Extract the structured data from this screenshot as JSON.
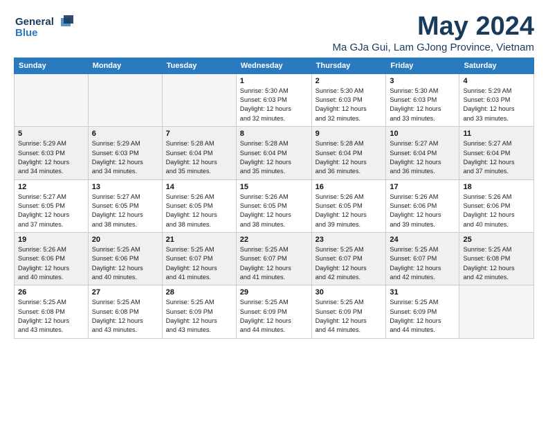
{
  "logo": {
    "line1": "General",
    "line2": "Blue"
  },
  "title": "May 2024",
  "location": "Ma GJa Gui, Lam GJong Province, Vietnam",
  "headers": [
    "Sunday",
    "Monday",
    "Tuesday",
    "Wednesday",
    "Thursday",
    "Friday",
    "Saturday"
  ],
  "weeks": [
    [
      {
        "day": "",
        "info": ""
      },
      {
        "day": "",
        "info": ""
      },
      {
        "day": "",
        "info": ""
      },
      {
        "day": "1",
        "info": "Sunrise: 5:30 AM\nSunset: 6:03 PM\nDaylight: 12 hours\nand 32 minutes."
      },
      {
        "day": "2",
        "info": "Sunrise: 5:30 AM\nSunset: 6:03 PM\nDaylight: 12 hours\nand 32 minutes."
      },
      {
        "day": "3",
        "info": "Sunrise: 5:30 AM\nSunset: 6:03 PM\nDaylight: 12 hours\nand 33 minutes."
      },
      {
        "day": "4",
        "info": "Sunrise: 5:29 AM\nSunset: 6:03 PM\nDaylight: 12 hours\nand 33 minutes."
      }
    ],
    [
      {
        "day": "5",
        "info": "Sunrise: 5:29 AM\nSunset: 6:03 PM\nDaylight: 12 hours\nand 34 minutes."
      },
      {
        "day": "6",
        "info": "Sunrise: 5:29 AM\nSunset: 6:03 PM\nDaylight: 12 hours\nand 34 minutes."
      },
      {
        "day": "7",
        "info": "Sunrise: 5:28 AM\nSunset: 6:04 PM\nDaylight: 12 hours\nand 35 minutes."
      },
      {
        "day": "8",
        "info": "Sunrise: 5:28 AM\nSunset: 6:04 PM\nDaylight: 12 hours\nand 35 minutes."
      },
      {
        "day": "9",
        "info": "Sunrise: 5:28 AM\nSunset: 6:04 PM\nDaylight: 12 hours\nand 36 minutes."
      },
      {
        "day": "10",
        "info": "Sunrise: 5:27 AM\nSunset: 6:04 PM\nDaylight: 12 hours\nand 36 minutes."
      },
      {
        "day": "11",
        "info": "Sunrise: 5:27 AM\nSunset: 6:04 PM\nDaylight: 12 hours\nand 37 minutes."
      }
    ],
    [
      {
        "day": "12",
        "info": "Sunrise: 5:27 AM\nSunset: 6:05 PM\nDaylight: 12 hours\nand 37 minutes."
      },
      {
        "day": "13",
        "info": "Sunrise: 5:27 AM\nSunset: 6:05 PM\nDaylight: 12 hours\nand 38 minutes."
      },
      {
        "day": "14",
        "info": "Sunrise: 5:26 AM\nSunset: 6:05 PM\nDaylight: 12 hours\nand 38 minutes."
      },
      {
        "day": "15",
        "info": "Sunrise: 5:26 AM\nSunset: 6:05 PM\nDaylight: 12 hours\nand 38 minutes."
      },
      {
        "day": "16",
        "info": "Sunrise: 5:26 AM\nSunset: 6:05 PM\nDaylight: 12 hours\nand 39 minutes."
      },
      {
        "day": "17",
        "info": "Sunrise: 5:26 AM\nSunset: 6:06 PM\nDaylight: 12 hours\nand 39 minutes."
      },
      {
        "day": "18",
        "info": "Sunrise: 5:26 AM\nSunset: 6:06 PM\nDaylight: 12 hours\nand 40 minutes."
      }
    ],
    [
      {
        "day": "19",
        "info": "Sunrise: 5:26 AM\nSunset: 6:06 PM\nDaylight: 12 hours\nand 40 minutes."
      },
      {
        "day": "20",
        "info": "Sunrise: 5:25 AM\nSunset: 6:06 PM\nDaylight: 12 hours\nand 40 minutes."
      },
      {
        "day": "21",
        "info": "Sunrise: 5:25 AM\nSunset: 6:07 PM\nDaylight: 12 hours\nand 41 minutes."
      },
      {
        "day": "22",
        "info": "Sunrise: 5:25 AM\nSunset: 6:07 PM\nDaylight: 12 hours\nand 41 minutes."
      },
      {
        "day": "23",
        "info": "Sunrise: 5:25 AM\nSunset: 6:07 PM\nDaylight: 12 hours\nand 42 minutes."
      },
      {
        "day": "24",
        "info": "Sunrise: 5:25 AM\nSunset: 6:07 PM\nDaylight: 12 hours\nand 42 minutes."
      },
      {
        "day": "25",
        "info": "Sunrise: 5:25 AM\nSunset: 6:08 PM\nDaylight: 12 hours\nand 42 minutes."
      }
    ],
    [
      {
        "day": "26",
        "info": "Sunrise: 5:25 AM\nSunset: 6:08 PM\nDaylight: 12 hours\nand 43 minutes."
      },
      {
        "day": "27",
        "info": "Sunrise: 5:25 AM\nSunset: 6:08 PM\nDaylight: 12 hours\nand 43 minutes."
      },
      {
        "day": "28",
        "info": "Sunrise: 5:25 AM\nSunset: 6:09 PM\nDaylight: 12 hours\nand 43 minutes."
      },
      {
        "day": "29",
        "info": "Sunrise: 5:25 AM\nSunset: 6:09 PM\nDaylight: 12 hours\nand 44 minutes."
      },
      {
        "day": "30",
        "info": "Sunrise: 5:25 AM\nSunset: 6:09 PM\nDaylight: 12 hours\nand 44 minutes."
      },
      {
        "day": "31",
        "info": "Sunrise: 5:25 AM\nSunset: 6:09 PM\nDaylight: 12 hours\nand 44 minutes."
      },
      {
        "day": "",
        "info": ""
      }
    ]
  ]
}
